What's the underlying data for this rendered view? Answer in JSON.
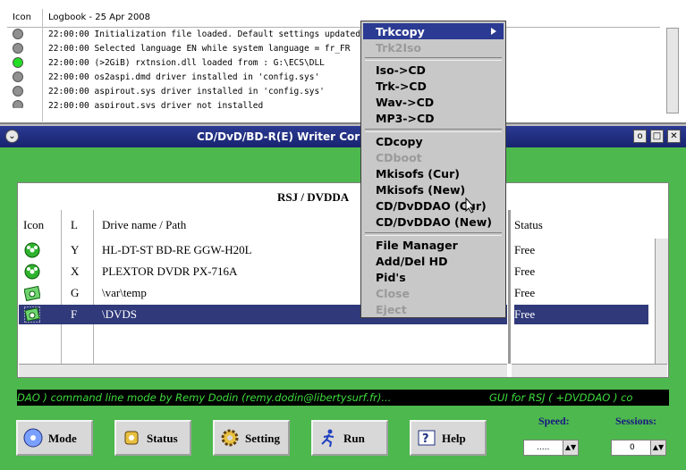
{
  "logbook": {
    "col_icon": "Icon",
    "title": "Logbook - 25 Apr 2008",
    "entries": [
      {
        "time": "22:00:00",
        "text": "Initialization file loaded. Default settings updated",
        "led": "#909090"
      },
      {
        "time": "22:00:00",
        "text": "Selected language EN while system language = fr_FR",
        "led": "#909090"
      },
      {
        "time": "22:00:00",
        "text": "(>2GiB) rxtnsion.dll loaded from : G:\\ECS\\DLL",
        "led": "#22dd22"
      },
      {
        "time": "22:00:00",
        "text": "os2aspi.dmd driver installed in 'config.sys'",
        "led": "#909090"
      },
      {
        "time": "22:00:00",
        "text": "aspirout.sys driver installed in 'config.sys'",
        "led": "#909090"
      },
      {
        "time": "22:00:00",
        "text": "aspirout.sys driver not installed",
        "led": "#909090"
      }
    ]
  },
  "window": {
    "title": "CD/DvD/BD-R(E) Writer Cor",
    "menu_icon": "chevron-down-icon",
    "min_label": "o",
    "max_label": "□",
    "close_label": "✕"
  },
  "panel": {
    "title": "RSJ / DVDDA",
    "headers": {
      "icon": "Icon",
      "letter": "L",
      "drive": "Drive name  / Path",
      "status": "Status"
    },
    "drives": [
      {
        "letter": "Y",
        "name": "HL-DT-ST BD-RE GGW-H20L",
        "status": "Free",
        "icon": "disc-icon"
      },
      {
        "letter": "X",
        "name": "PLEXTOR DVDR PX-716A",
        "status": "Free",
        "icon": "disc-icon"
      },
      {
        "letter": "G",
        "name": "\\var\\temp",
        "status": "Free",
        "icon": "folder-disc-icon"
      },
      {
        "letter": "F",
        "name": "\\DVDS",
        "status": "Free",
        "icon": "folder-disc-icon"
      }
    ]
  },
  "ticker": {
    "left": "DAO ) command line mode by Remy Dodin (remy.dodin@libertysurf.fr)...",
    "right": "GUI for RSJ ( +DVDDAO ) co"
  },
  "buttons": {
    "mode": "Mode",
    "status": "Status",
    "setting": "Setting",
    "run": "Run",
    "help": "Help"
  },
  "speed": {
    "label": "Speed:",
    "value": "....."
  },
  "sessions": {
    "label": "Sessions:",
    "value": "0"
  },
  "menu": {
    "items": [
      {
        "label": "Trkcopy",
        "state": "highlighted"
      },
      {
        "label": "Trk2Iso",
        "state": "disabled"
      },
      {
        "label": "Iso->CD",
        "state": "normal"
      },
      {
        "label": "Trk->CD",
        "state": "normal"
      },
      {
        "label": "Wav->CD",
        "state": "normal"
      },
      {
        "label": "MP3->CD",
        "state": "normal"
      },
      {
        "label": "CDcopy",
        "state": "normal"
      },
      {
        "label": "CDboot",
        "state": "disabled"
      },
      {
        "label": "Mkisofs (Cur)",
        "state": "normal"
      },
      {
        "label": "Mkisofs (New)",
        "state": "normal"
      },
      {
        "label": "CD/DvDDAO (Cur)",
        "state": "normal"
      },
      {
        "label": "CD/DvDDAO (New)",
        "state": "normal"
      },
      {
        "label": "File Manager",
        "state": "normal"
      },
      {
        "label": "Add/Del HD",
        "state": "normal"
      },
      {
        "label": "Pid's",
        "state": "normal"
      },
      {
        "label": "Close",
        "state": "disabled"
      },
      {
        "label": "Eject",
        "state": "disabled"
      }
    ]
  },
  "colors": {
    "highlight": "#2b3a92",
    "window_bg": "#4db84d",
    "ticker_fg": "#3ddc3d"
  }
}
